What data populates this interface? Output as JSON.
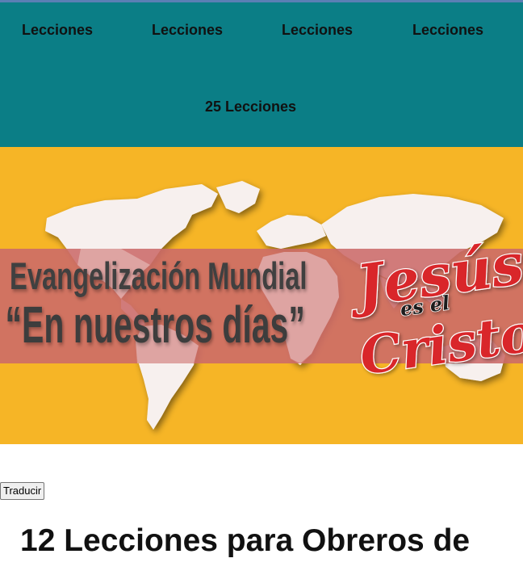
{
  "nav": {
    "items": [
      {
        "label": "Lecciones"
      },
      {
        "label": "Lecciones"
      },
      {
        "label": "Lecciones"
      },
      {
        "label": "Lecciones"
      },
      {
        "label": "25 Lecciones"
      }
    ]
  },
  "banner": {
    "line1": "Evangelización  Mundial",
    "line2": "“En nuestros días”",
    "logo_word1": "Jesús",
    "logo_word2": "es el",
    "logo_word3": "Cristo",
    "colors": {
      "background": "#f6b526",
      "band": "#cc6a6a",
      "map": "#f7f0ee",
      "text": "#404040",
      "logo": "#d9262c"
    }
  },
  "translate": {
    "label": "Traducir"
  },
  "main": {
    "title": "12 Lecciones para Obreros de"
  },
  "colors": {
    "nav_bg": "#0b7e86",
    "accent_line": "#5b7fb4"
  }
}
